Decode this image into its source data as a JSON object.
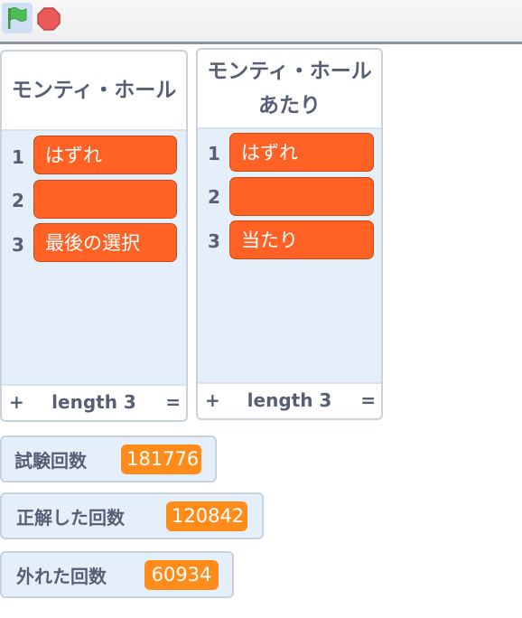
{
  "toolbar": {
    "green_flag_icon": "green-flag-icon",
    "stop_icon": "stop-sign-icon",
    "colors": {
      "flag": "#4cbf56",
      "stop": "#ec5959",
      "active_bg": "#cfe0f5"
    }
  },
  "lists": [
    {
      "title": "モンティ・ホール",
      "items": [
        {
          "index": "1",
          "value": "はずれ"
        },
        {
          "index": "2",
          "value": ""
        },
        {
          "index": "3",
          "value": "最後の選択"
        }
      ],
      "footer": {
        "plus": "+",
        "length_label": "length 3",
        "equals": "="
      }
    },
    {
      "title": "モンティ・ホール　あたり",
      "items": [
        {
          "index": "1",
          "value": "はずれ"
        },
        {
          "index": "2",
          "value": ""
        },
        {
          "index": "3",
          "value": "当たり"
        }
      ],
      "footer": {
        "plus": "+",
        "length_label": "length 3",
        "equals": "="
      }
    }
  ],
  "variables": [
    {
      "label": "試験回数",
      "value": "181776"
    },
    {
      "label": "正解した回数",
      "value": "120842"
    },
    {
      "label": "外れた回数",
      "value": "60934"
    }
  ],
  "colors": {
    "list_item": "#ff6224",
    "variable_value": "#ff8c1a",
    "monitor_bg": "#e5effa",
    "text": "#575e75"
  }
}
